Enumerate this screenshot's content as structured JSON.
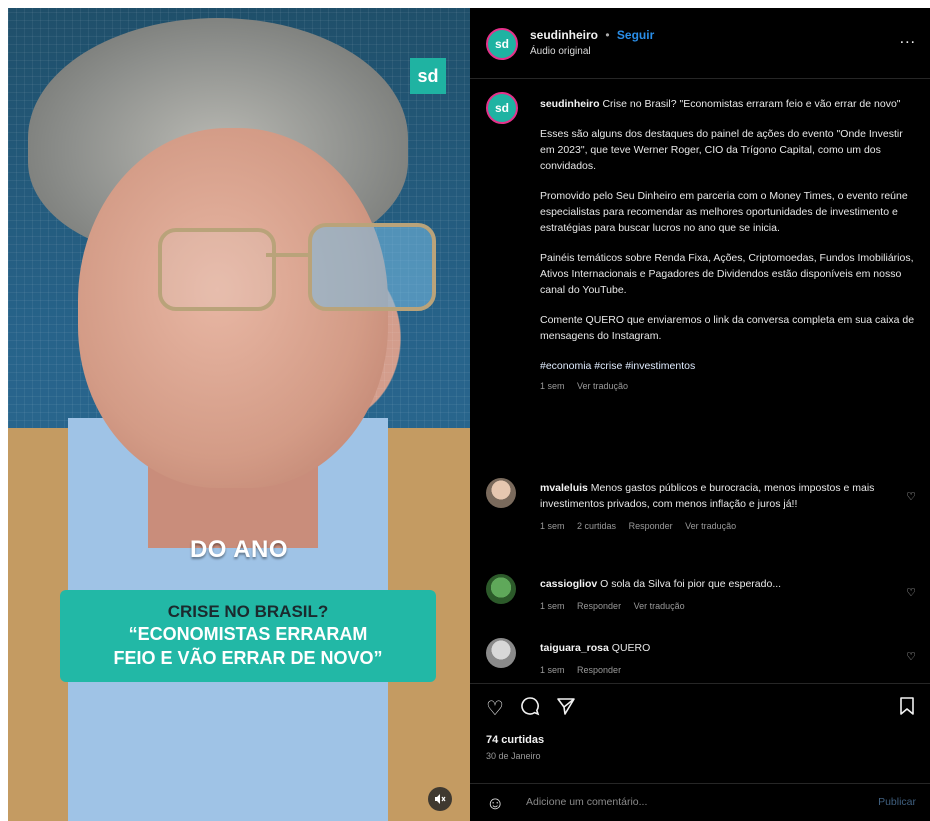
{
  "media": {
    "logo_text": "sd",
    "caption_top": "DO ANO",
    "caption_line1": "CRISE NO BRASIL?",
    "caption_line2": "“ECONOMISTAS ERRARAM",
    "caption_line3": "FEIO E VÃO ERRAR DE NOVO”",
    "mute_icon": "speaker-muted-icon"
  },
  "header": {
    "username": "seudinheiro",
    "separator": "•",
    "follow_label": "Seguir",
    "audio": "Áudio original",
    "more": "..."
  },
  "post": {
    "username": "seudinheiro",
    "title": "Crise no Brasil? \"Economistas erraram feio e vão errar de novo\"",
    "p1": "Esses são alguns dos destaques do painel de ações do evento \"Onde Investir em 2023\", que teve Werner Roger, CIO da Trígono Capital, como um dos convidados.",
    "p2": "Promovido pelo Seu Dinheiro em parceria com o Money Times, o evento reúne especialistas para recomendar as melhores oportunidades de investimento e estratégias para buscar lucros no ano que se inicia.",
    "p3": "Painéis temáticos sobre Renda Fixa, Ações, Criptomoedas, Fundos Imobiliários, Ativos Internacionais e Pagadores de Dividendos estão disponíveis em nosso canal do YouTube.",
    "p4": "Comente QUERO que enviaremos o link da conversa completa em sua caixa de mensagens do Instagram.",
    "tags": "#economia #crise #investimentos",
    "time": "1 sem",
    "translate": "Ver tradução"
  },
  "comments": [
    {
      "username": "mvaleluis",
      "text": "Menos gastos públicos e burocracia, menos impostos e mais investimentos privados, com menos inflação e juros já!!",
      "time": "1 sem",
      "likes": "2 curtidas",
      "reply": "Responder",
      "translate": "Ver tradução"
    },
    {
      "username": "cassiogliov",
      "text": "O sola da Silva foi pior que esperado...",
      "time": "1 sem",
      "reply": "Responder",
      "translate": "Ver tradução"
    },
    {
      "username": "taiguara_rosa",
      "text": "QUERO",
      "time": "1 sem",
      "reply": "Responder"
    }
  ],
  "actions": {
    "likes": "74 curtidas",
    "date": "30 de Janeiro"
  },
  "compose": {
    "placeholder": "Adicione um comentário...",
    "publish": "Publicar"
  }
}
